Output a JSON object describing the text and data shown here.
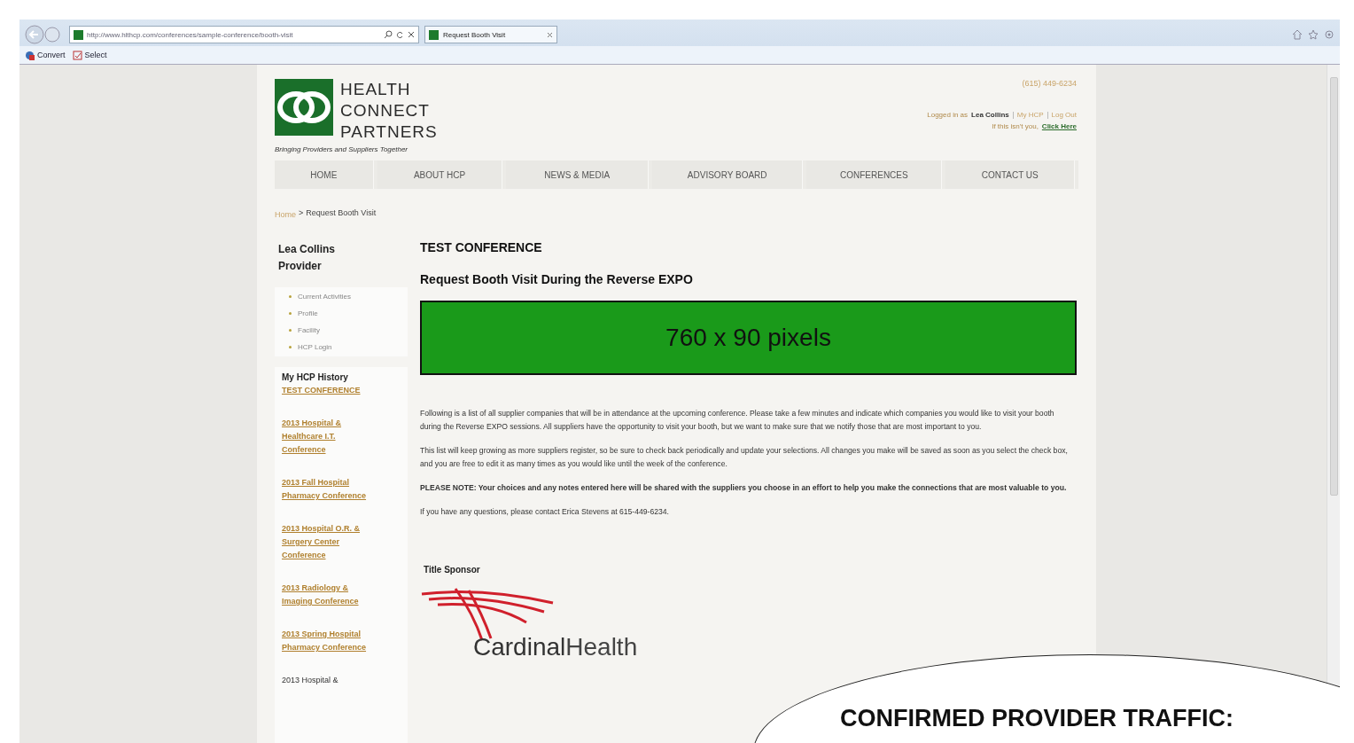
{
  "browser": {
    "address": "http://www.hlthcp.com/conferences/sample-conference/booth-visit",
    "tab_title": "Request Booth Visit",
    "toolbar": [
      "Convert",
      "Select"
    ]
  },
  "header": {
    "logo_lines": [
      "HEALTH",
      "CONNECT",
      "PARTNERS"
    ],
    "tagline": "Bringing Providers and Suppliers Together",
    "phone": "(615) 449-6234",
    "logged_in_label": "Logged in as",
    "user_name": "Lea Collins",
    "links": [
      "My HCP",
      "Log Out"
    ],
    "not_you": "If this isn't you,",
    "click_here": "Click Here"
  },
  "nav": [
    {
      "label": "HOME"
    },
    {
      "label": "ABOUT HCP"
    },
    {
      "label": "NEWS & MEDIA"
    },
    {
      "label": "ADVISORY BOARD"
    },
    {
      "label": "CONFERENCES"
    },
    {
      "label": "CONTACT US"
    }
  ],
  "breadcrumb": {
    "home": "Home",
    "separator": ">",
    "current": "Request Booth Visit"
  },
  "sidebar": {
    "name": "Lea Collins",
    "role": "Provider",
    "menu": [
      "Current Activities",
      "Profile",
      "Facility",
      "HCP Login"
    ],
    "history_title": "My HCP History",
    "history": [
      {
        "label": "TEST CONFERENCE",
        "kind": "link"
      },
      {
        "label": "2013 Hospital & Healthcare I.T. Conference",
        "kind": "link"
      },
      {
        "label": "2013 Fall Hospital Pharmacy Conference",
        "kind": "link"
      },
      {
        "label": "2013 Hospital O.R. & Surgery Center Conference",
        "kind": "link"
      },
      {
        "label": "2013 Radiology & Imaging Conference",
        "kind": "link"
      },
      {
        "label": "2013 Spring Hospital Pharmacy Conference",
        "kind": "link"
      },
      {
        "label": "2013 Hospital &",
        "kind": "text"
      }
    ]
  },
  "main": {
    "title": "TEST CONFERENCE",
    "subtitle": "Request Booth Visit During the Reverse EXPO",
    "banner": "760 x 90 pixels",
    "paragraphs": [
      {
        "kind": "plain",
        "text": "Following is a list of all supplier companies that will be in attendance at the upcoming conference. Please take a few minutes and indicate which companies you would like to visit your booth during the Reverse EXPO sessions. All suppliers have the opportunity to visit your booth, but we want to make sure that we notify those that are most important to you."
      },
      {
        "kind": "plain",
        "text": "This list will keep growing as more suppliers register, so be sure to check back periodically and update your selections. All changes you make will be saved as soon as you select the check box, and you are free to edit it as many times as you would like until the week of the conference."
      },
      {
        "kind": "note",
        "text": "PLEASE NOTE: Your choices and any notes entered here will be shared with the suppliers you choose in an effort to help you make the connections that are most valuable to you."
      },
      {
        "kind": "plain",
        "text": "If you have any questions, please contact Erica Stevens at 615-449-6234."
      }
    ],
    "sponsor_label": "Title Sponsor",
    "sponsor_logo": {
      "bold": "Cardinal",
      "light": "Health"
    }
  },
  "callout": {
    "text": "CONFIRMED PROVIDER TRAFFIC:"
  }
}
